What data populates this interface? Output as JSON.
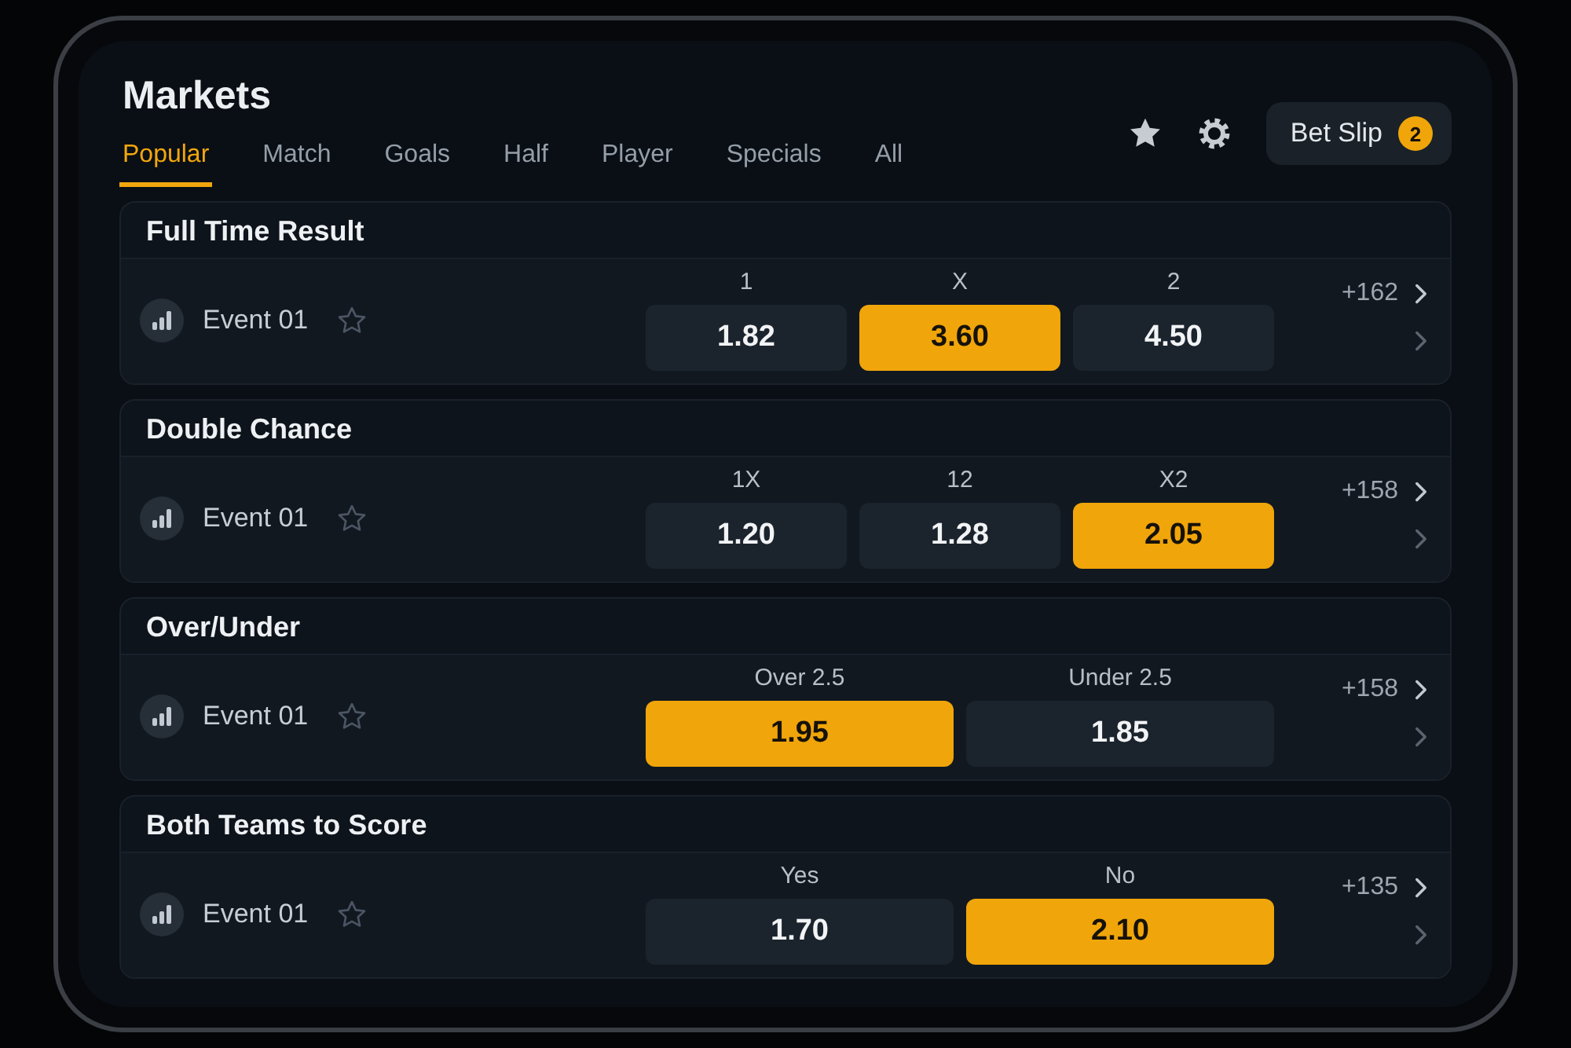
{
  "header": {
    "title": "Markets",
    "tabs": [
      {
        "label": "Popular",
        "selected": true
      },
      {
        "label": "Match",
        "selected": false
      },
      {
        "label": "Goals",
        "selected": false
      },
      {
        "label": "Half",
        "selected": false
      },
      {
        "label": "Player",
        "selected": false
      },
      {
        "label": "Specials",
        "selected": false
      },
      {
        "label": "All",
        "selected": false
      }
    ],
    "bet_slip": {
      "label": "Bet Slip",
      "count": "2"
    }
  },
  "markets": [
    {
      "title": "Full Time Result",
      "event": "Event 01",
      "favorite": false,
      "more": "+162",
      "outcomes": [
        {
          "label": "1",
          "odds": "1.82",
          "selected": false
        },
        {
          "label": "X",
          "odds": "3.60",
          "selected": true
        },
        {
          "label": "2",
          "odds": "4.50",
          "selected": false
        }
      ]
    },
    {
      "title": "Double Chance",
      "event": "Event 01",
      "favorite": false,
      "more": "+158",
      "outcomes": [
        {
          "label": "1X",
          "odds": "1.20",
          "selected": false
        },
        {
          "label": "12",
          "odds": "1.28",
          "selected": false
        },
        {
          "label": "X2",
          "odds": "2.05",
          "selected": true
        }
      ]
    },
    {
      "title": "Over/Under",
      "event": "Event 01",
      "favorite": false,
      "more": "+158",
      "outcomes": [
        {
          "label": "Over 2.5",
          "odds": "1.95",
          "selected": true
        },
        {
          "label": "Under 2.5",
          "odds": "1.85",
          "selected": false
        }
      ]
    },
    {
      "title": "Both Teams to Score",
      "event": "Event 01",
      "favorite": false,
      "more": "+135",
      "outcomes": [
        {
          "label": "Yes",
          "odds": "1.70",
          "selected": false
        },
        {
          "label": "No",
          "odds": "2.10",
          "selected": true
        }
      ]
    }
  ]
}
